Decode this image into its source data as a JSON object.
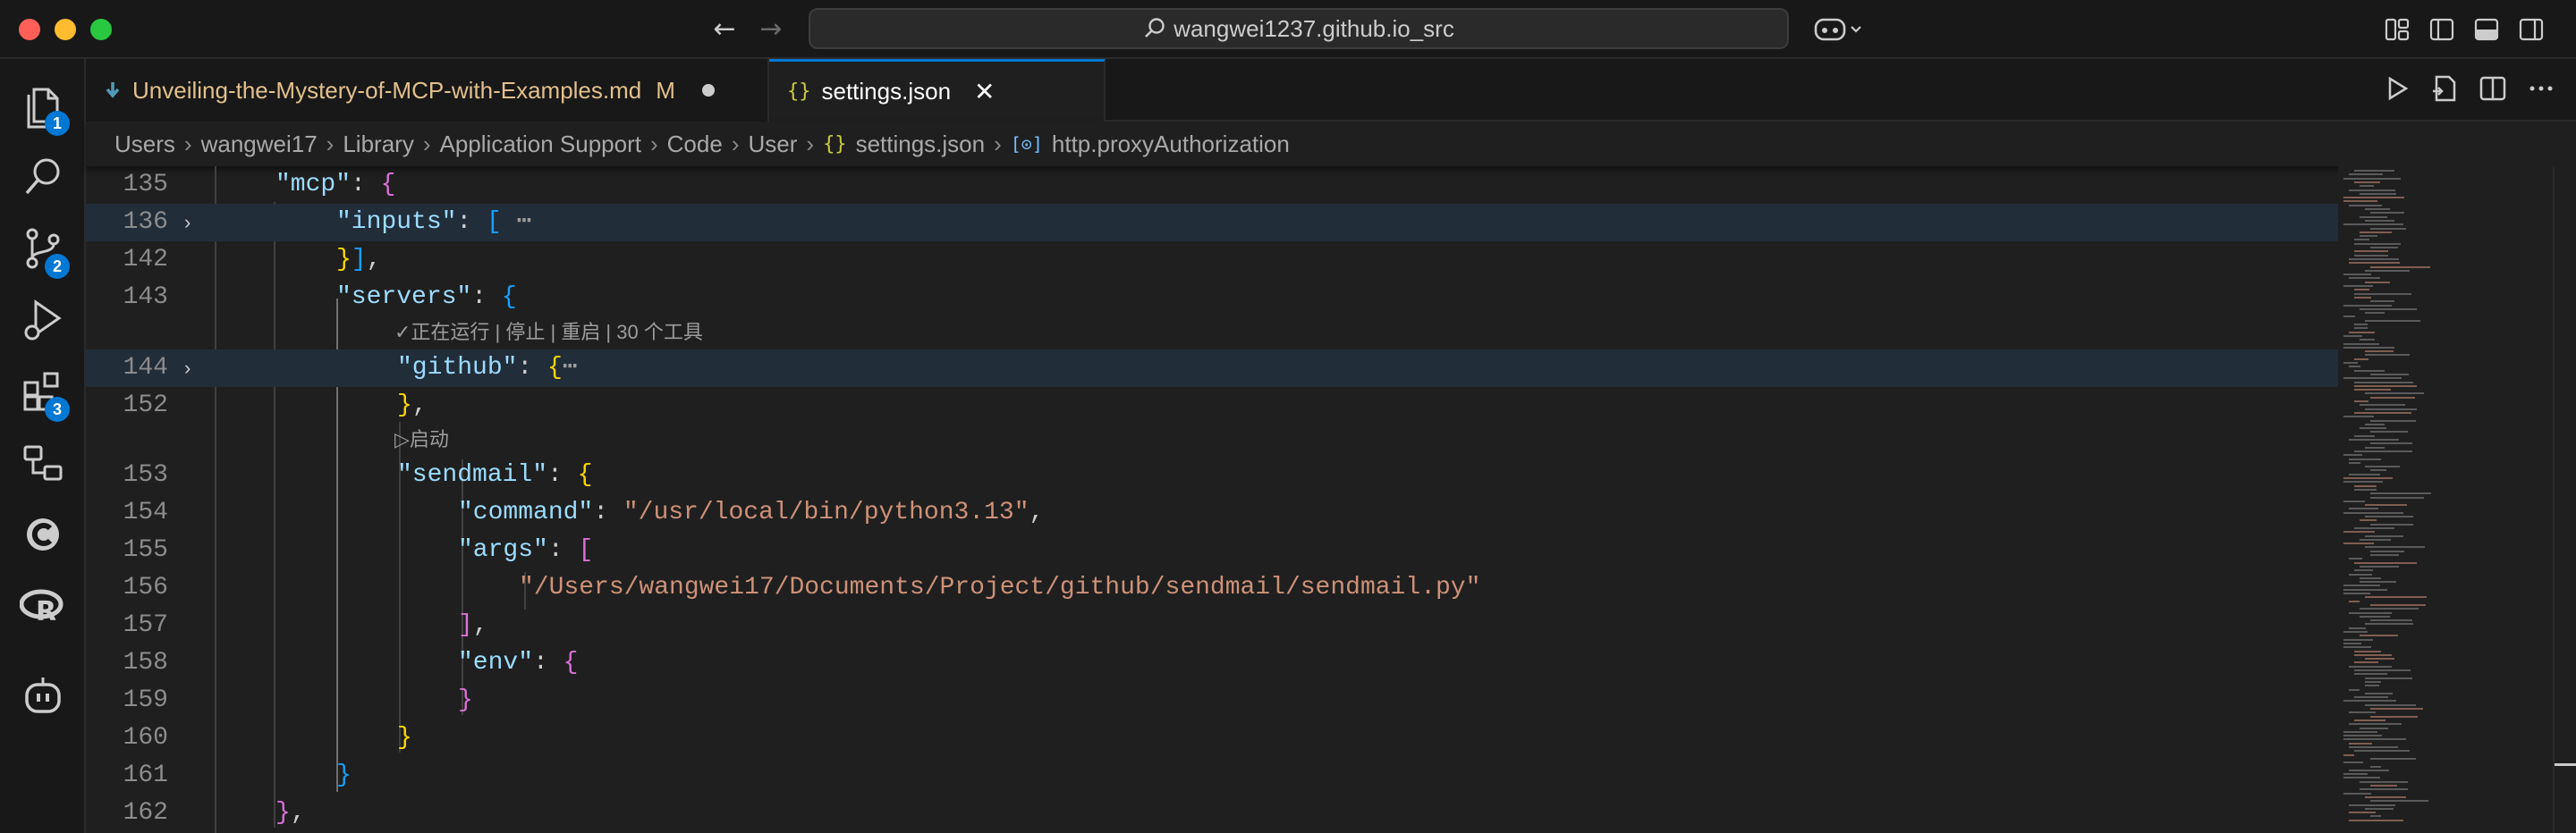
{
  "window": {
    "command_center": "wangwei1237.github.io_src",
    "nav_back": "←",
    "nav_forward": "→"
  },
  "activity_bar": {
    "explorer_badge": "1",
    "source_control_badge": "2",
    "extensions_badge": "3"
  },
  "tabs": [
    {
      "label": "Unveiling-the-Mystery-of-MCP-with-Examples.md",
      "status": "M",
      "icon": "markdown-icon"
    },
    {
      "label": "settings.json",
      "icon": "json-braces-icon"
    }
  ],
  "breadcrumb": [
    "Users",
    "wangwei17",
    "Library",
    "Application Support",
    "Code",
    "User",
    "settings.json",
    "http.proxyAuthorization"
  ],
  "editor": {
    "line_numbers": [
      "135",
      "136",
      "142",
      "143",
      "144",
      "152",
      "153",
      "154",
      "155",
      "156",
      "157",
      "158",
      "159",
      "160",
      "161",
      "162"
    ],
    "lens_github": "✓正在运行 | 停止 | 重启 | 30 个工具",
    "lens_sendmail": "▷启动",
    "keys": {
      "mcp": "\"mcp\"",
      "inputs": "\"inputs\"",
      "servers": "\"servers\"",
      "github": "\"github\"",
      "sendmail": "\"sendmail\"",
      "command": "\"command\"",
      "args": "\"args\"",
      "env": "\"env\""
    },
    "values": {
      "command": "\"/usr/local/bin/python3.13\"",
      "arg0": "\"/Users/wangwei17/Documents/Project/github/sendmail/sendmail.py\""
    }
  },
  "colors": {
    "accent": "#0078d4",
    "editor_bg": "#1f1f1f",
    "json_key": "#9cdcfe",
    "json_string": "#ce9178",
    "bracket_gold": "#ffd700",
    "bracket_orchid": "#da70d6",
    "bracket_blue": "#179fff",
    "modified_tab": "#e2c08d"
  }
}
